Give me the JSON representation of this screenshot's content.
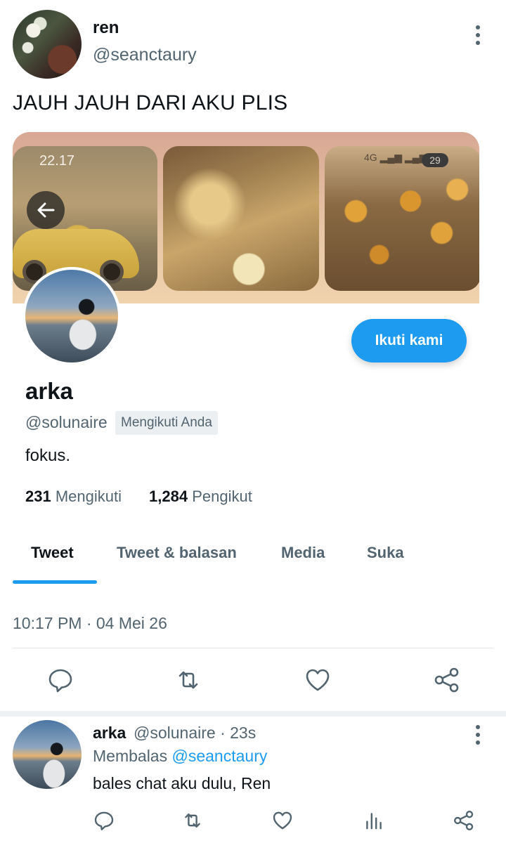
{
  "tweet": {
    "author_name": "ren",
    "author_handle": "@seanctaury",
    "text": "JAUH JAUH DARI AKU PLIS",
    "timestamp": "10:17 PM · 04 Mei 26"
  },
  "screenshot": {
    "status_time": "22.17",
    "network": "4G",
    "battery": "29",
    "profile": {
      "name": "arka",
      "handle": "@solunaire",
      "follows_you_badge": "Mengikuti Anda",
      "bio": "fokus.",
      "following_count": "231",
      "following_label": "Mengikuti",
      "followers_count": "1,284",
      "followers_label": "Pengikut",
      "follow_button": "Ikuti kami",
      "tabs": [
        "Tweet",
        "Tweet & balasan",
        "Media",
        "Suka"
      ],
      "active_tab": "Tweet"
    }
  },
  "reply": {
    "author_name": "arka",
    "author_handle": "@solunaire · 23s",
    "replying_prefix": "Membalas",
    "replying_to": "@seanctaury",
    "text": "bales chat aku dulu, Ren"
  },
  "icons": {
    "reply": "reply-icon",
    "retweet": "retweet-icon",
    "like": "heart-icon",
    "views": "views-icon",
    "share": "share-icon",
    "more": "more-vertical-icon",
    "back": "arrow-left-icon"
  },
  "colors": {
    "accent": "#1d9bf0",
    "text_primary": "#0f1419",
    "text_secondary": "#536471"
  }
}
